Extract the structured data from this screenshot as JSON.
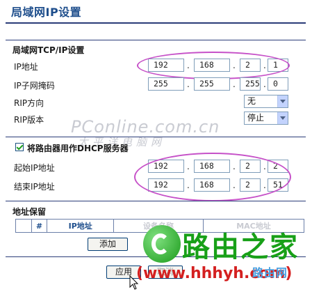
{
  "page": {
    "title": "局域网IP设置"
  },
  "lan_section": {
    "heading": "局域网TCP/IP设置",
    "ip_label": "IP地址",
    "ip": [
      "192",
      "168",
      "2",
      "1"
    ],
    "mask_label": "IP子网掩码",
    "mask": [
      "255",
      "255",
      "255",
      "0"
    ],
    "rip_dir_label": "RIP方向",
    "rip_dir_value": "无",
    "rip_ver_label": "RIP版本",
    "rip_ver_value": "停止",
    "dot": "."
  },
  "dhcp": {
    "checkbox_label": "将路由器用作DHCP服务器",
    "checked": true,
    "start_label": "起始IP地址",
    "start_ip": [
      "192",
      "168",
      "2",
      "2"
    ],
    "end_label": "结束IP地址",
    "end_ip": [
      "192",
      "168",
      "2",
      "51"
    ]
  },
  "reservation": {
    "heading": "地址保留",
    "columns": [
      "",
      "#",
      "IP地址",
      "设备名称",
      "MAC地址"
    ],
    "add_button": "添加"
  },
  "footer": {
    "apply_button": "应用",
    "cancel_button": "取消"
  },
  "watermarks": {
    "pconline": "PConline.com.cn",
    "pconline_cn": "太平洋电脑网",
    "brand_text": "路由之家",
    "brand_url": "(www.hhhyh.com)",
    "brand_small": "路由网"
  },
  "colors": {
    "title": "#1e4e8c",
    "rule": "#2a3c78",
    "ellipse": "#c651c8",
    "brand_green": "#18a018",
    "brand_red": "#d42020"
  }
}
